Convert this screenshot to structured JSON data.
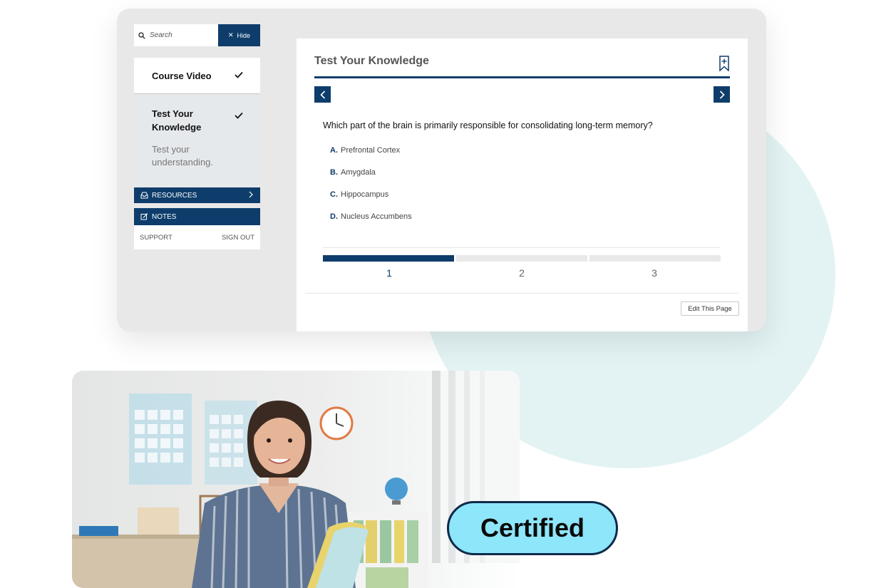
{
  "sidebar": {
    "search_placeholder": "Search",
    "hide_label": "Hide",
    "lessons": [
      {
        "title": "Course Video"
      },
      {
        "title": "Test Your Knowledge",
        "description": "Test your understanding."
      }
    ],
    "resources_label": "RESOURCES",
    "notes_label": "NOTES",
    "support_label": "SUPPORT",
    "signout_label": "SIGN OUT"
  },
  "main": {
    "title": "Test Your Knowledge",
    "question": "Which part of the brain is primarily responsible for consolidating long-term memory?",
    "answers": [
      {
        "letter": "A.",
        "text": "Prefrontal Cortex"
      },
      {
        "letter": "B.",
        "text": "Amygdala"
      },
      {
        "letter": "C.",
        "text": "Hippocampus"
      },
      {
        "letter": "D.",
        "text": "Nucleus Accumbens"
      }
    ],
    "steps": [
      "1",
      "2",
      "3"
    ],
    "current_step": 1,
    "edit_label": "Edit This Page"
  },
  "badge": {
    "label": "Certified"
  },
  "colors": {
    "brand_navy": "#0e3d6b",
    "badge_fill": "#8ee6fa",
    "bg_circle": "#e3f3f4"
  }
}
